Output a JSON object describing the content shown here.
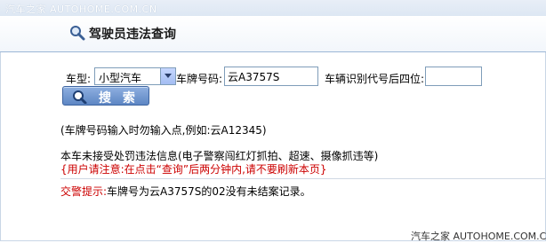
{
  "watermark_top": "汽车之家 AUTOHOME.COM.CN",
  "header": {
    "title": "驾驶员违法查询",
    "icon": "magnifier-icon"
  },
  "form": {
    "vehicle_type_label": "车型:",
    "vehicle_type_value": "小型汽车",
    "plate_label": "车牌号码:",
    "plate_value": "云A3757S",
    "vin_label": "车辆识别代号后四位:",
    "vin_value": "",
    "search_button_label": "搜 索"
  },
  "hint": "(车牌号码输入时勿输入点,例如:云A12345)",
  "note": "本车未接受处罚违法信息(电子警察闯红灯抓拍、超速、摄像抓违等)",
  "warning": "{用户请注意:在点击“查询”后两分钟内,请不要刷新本页}",
  "result": {
    "label": "交警提示:",
    "text": "车牌号为云A3757S的02没有未结案记录。"
  },
  "watermark_bottom": "汽车之家 AUTOHOME.COM.CN",
  "colors": {
    "header_border": "#9cb7d6",
    "warning": "#cc0000",
    "button": "#5d86c4"
  }
}
